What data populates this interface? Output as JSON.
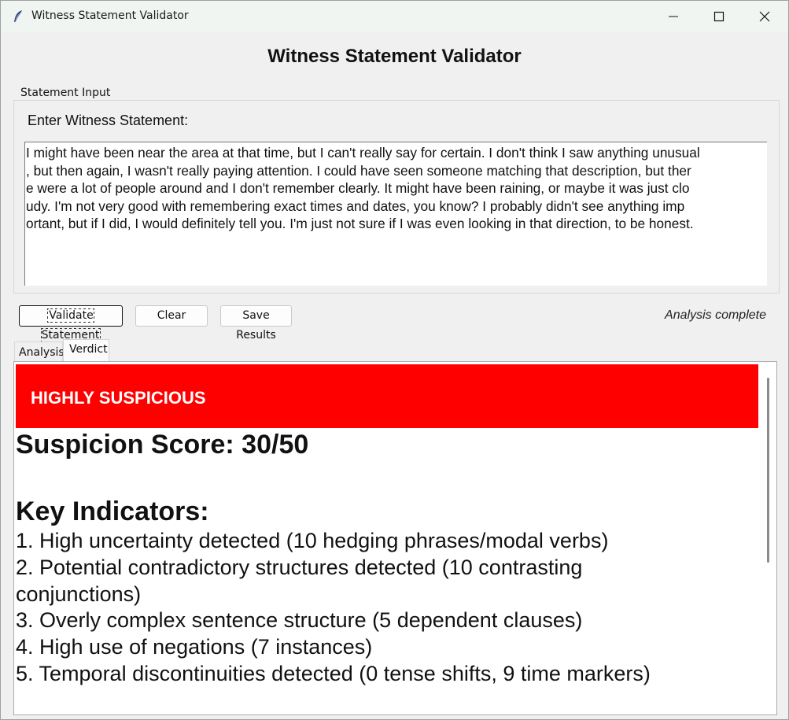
{
  "window": {
    "title": "Witness Statement Validator",
    "icon": "feather-icon"
  },
  "heading": "Witness Statement Validator",
  "input_group": {
    "label": "Statement Input",
    "field_label": "Enter Witness Statement:",
    "statement_lines": [
      "I might have been near the area at that time, but I can't really say for certain. I don't think I saw anything unusual",
      ", but then again, I wasn't really paying attention. I could have seen someone matching that description, but ther",
      "e were a lot of people around and I don't remember clearly. It might have been raining, or maybe it was just clo",
      "udy. I'm not very good with remembering exact times and dates, you know? I probably didn't see anything imp",
      "ortant, but if I did, I would definitely tell you. I'm just not sure if I was even looking in that direction, to be honest."
    ]
  },
  "toolbar": {
    "validate_label": "Validate Statement",
    "clear_label": "Clear",
    "save_label": "Save Results",
    "status": "Analysis complete"
  },
  "tabs": [
    {
      "label": "Analysis",
      "selected": false
    },
    {
      "label": "Verdict",
      "selected": true
    }
  ],
  "verdict": {
    "banner": "HIGHLY SUSPICIOUS",
    "banner_color": "#ff0000",
    "score": "Suspicion Score: 30/50",
    "indicators_title": "Key Indicators:",
    "indicators": [
      "1. High uncertainty detected (10 hedging phrases/modal verbs)",
      "2. Potential contradictory structures detected (10 contrasting",
      "conjunctions)",
      "3. Overly complex sentence structure (5 dependent clauses)",
      "4. High use of negations (7 instances)",
      "5. Temporal discontinuities detected (0 tense shifts, 9 time markers)"
    ]
  }
}
